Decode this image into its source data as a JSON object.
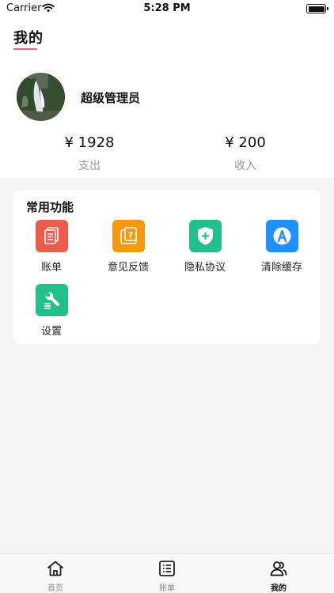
{
  "status_bar": {
    "carrier": "Carrier",
    "time": "5:28 PM"
  },
  "page": {
    "title": "我的"
  },
  "profile": {
    "name": "超级管理员"
  },
  "stats": {
    "expense": {
      "value": "¥ 1928",
      "label": "支出"
    },
    "income": {
      "value": "¥ 200",
      "label": "收入"
    }
  },
  "functions": {
    "title": "常用功能",
    "items": [
      {
        "label": "账单",
        "icon": "bill-icon",
        "color": "#ef5a4a"
      },
      {
        "label": "意见反馈",
        "icon": "feedback-icon",
        "color": "#f7990e"
      },
      {
        "label": "隐私协议",
        "icon": "shield-plus-icon",
        "color": "#1fc08a"
      },
      {
        "label": "清除缓存",
        "icon": "clear-cache-icon",
        "color": "#1e90ff"
      },
      {
        "label": "设置",
        "icon": "wrench-icon",
        "color": "#1fc08a"
      }
    ]
  },
  "tab_bar": {
    "items": [
      {
        "label": "首页",
        "icon": "home-icon",
        "active": false
      },
      {
        "label": "账单",
        "icon": "list-icon",
        "active": false
      },
      {
        "label": "我的",
        "icon": "user-icon",
        "active": true
      }
    ]
  }
}
